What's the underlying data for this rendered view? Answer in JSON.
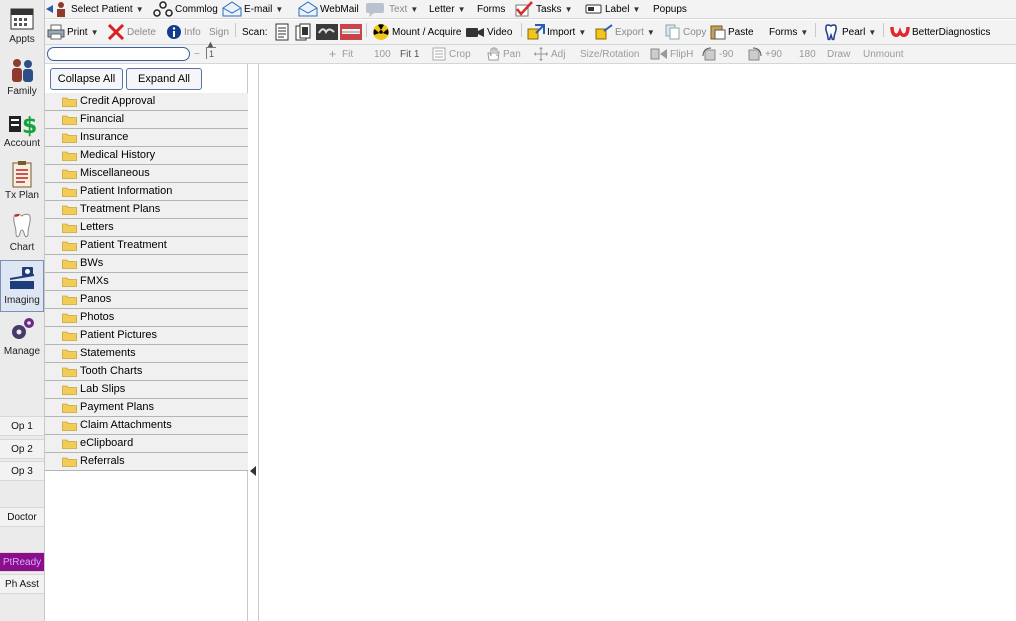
{
  "modules": [
    {
      "label": "Appts",
      "icon": "calendar-icon",
      "active": false
    },
    {
      "label": "Family",
      "icon": "family-icon",
      "active": false
    },
    {
      "label": "Account",
      "icon": "account-dollar-icon",
      "active": false
    },
    {
      "label": "Tx Plan",
      "icon": "clipboard-icon",
      "active": false
    },
    {
      "label": "Chart",
      "icon": "tooth-icon",
      "active": false
    },
    {
      "label": "Imaging",
      "icon": "scanner-icon",
      "active": true
    },
    {
      "label": "Manage",
      "icon": "gears-icon",
      "active": false
    }
  ],
  "op_buttons": [
    "Op 1",
    "Op 2",
    "Op 3",
    "Doctor",
    "PtReady",
    "Ph Asst"
  ],
  "toolbar_main": {
    "select_patient": "Select Patient",
    "commlog": "Commlog",
    "email": "E-mail",
    "webmail": "WebMail",
    "text": "Text",
    "letter": "Letter",
    "forms": "Forms",
    "tasks": "Tasks",
    "label": "Label",
    "popups": "Popups"
  },
  "toolbar_imaging": {
    "print": "Print",
    "delete": "Delete",
    "info": "Info",
    "sign": "Sign",
    "scan": "Scan:",
    "mount_acquire": "Mount / Acquire",
    "video": "Video",
    "import": "Import",
    "export": "Export",
    "copy": "Copy",
    "paste": "Paste",
    "forms": "Forms",
    "pearl": "Pearl",
    "better_diagnostics": "BetterDiagnostics"
  },
  "toolbar_view": {
    "zoom_value": "1",
    "minus": "−",
    "plus": "+",
    "fit": "Fit",
    "hundred": "100",
    "fit1": "Fit 1",
    "crop": "Crop",
    "pan": "Pan",
    "adj": "Adj",
    "size_rotation": "Size/Rotation",
    "fliph": "FlipH",
    "rot_minus90": "-90",
    "rot_plus90": "+90",
    "rot_180": "180",
    "draw": "Draw",
    "unmount": "Unmount"
  },
  "tree": {
    "collapse_all": "Collapse All",
    "expand_all": "Expand All",
    "folders": [
      "Credit Approval",
      "Financial",
      "Insurance",
      "Medical History",
      "Miscellaneous",
      "Patient Information",
      "Treatment Plans",
      "Letters",
      "Patient Treatment",
      "BWs",
      "FMXs",
      "Panos",
      "Photos",
      "Patient Pictures",
      "Statements",
      "Tooth Charts",
      "Lab Slips",
      "Payment Plans",
      "Claim Attachments",
      "eClipboard",
      "Referrals"
    ]
  },
  "colors": {
    "ptready_bg": "#8b0e8b",
    "ptready_text": "#d9a7ff",
    "folder_yellow": "#f3cc56",
    "button_border": "#5873a6"
  }
}
